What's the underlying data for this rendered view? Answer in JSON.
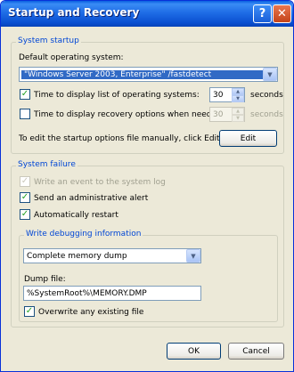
{
  "window": {
    "title": "Startup and Recovery",
    "help_glyph": "?",
    "close_glyph": "✕"
  },
  "system_startup": {
    "group_label": "System startup",
    "default_os_label": "Default operating system:",
    "default_os_value": "\"Windows Server 2003, Enterprise\" /fastdetect",
    "display_list": {
      "label": "Time to display list of operating systems:",
      "checked": true,
      "value": "30",
      "unit": "seconds"
    },
    "display_recovery": {
      "label": "Time to display recovery options when needed:",
      "checked": false,
      "value": "30",
      "unit": "seconds"
    },
    "edit_text": "To edit the startup options file manually, click Edit.",
    "edit_button": "Edit"
  },
  "system_failure": {
    "group_label": "System failure",
    "write_event": {
      "label": "Write an event to the system log",
      "checked": true,
      "disabled": true
    },
    "send_alert": {
      "label": "Send an administrative alert",
      "checked": true
    },
    "auto_restart": {
      "label": "Automatically restart",
      "checked": true
    }
  },
  "debug_info": {
    "group_label": "Write debugging information",
    "dump_type": "Complete memory dump",
    "dump_file_label": "Dump file:",
    "dump_file_value": "%SystemRoot%\\MEMORY.DMP",
    "overwrite": {
      "label": "Overwrite any existing file",
      "checked": true
    }
  },
  "buttons": {
    "ok": "OK",
    "cancel": "Cancel"
  },
  "glyphs": {
    "check": "✓",
    "dropdown": "▼",
    "spin_up": "▲",
    "spin_down": "▼"
  }
}
